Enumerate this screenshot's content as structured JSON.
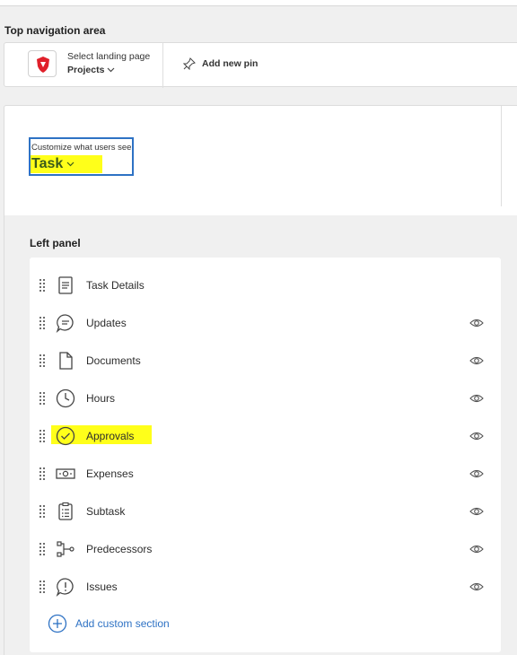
{
  "top_nav": {
    "section_title": "Top navigation area",
    "landing_label": "Select landing page",
    "landing_value": "Projects",
    "pin_label": "Add new pin"
  },
  "customize": {
    "label": "Customize what users see",
    "value": "Task"
  },
  "left_panel": {
    "title": "Left panel",
    "items": [
      {
        "label": "Task Details",
        "icon": "document-lines-icon",
        "visibility_toggle": false,
        "highlighted": false
      },
      {
        "label": "Updates",
        "icon": "chat-bubble-icon",
        "visibility_toggle": true,
        "highlighted": false
      },
      {
        "label": "Documents",
        "icon": "file-icon",
        "visibility_toggle": true,
        "highlighted": false
      },
      {
        "label": "Hours",
        "icon": "clock-icon",
        "visibility_toggle": true,
        "highlighted": false
      },
      {
        "label": "Approvals",
        "icon": "check-circle-icon",
        "visibility_toggle": true,
        "highlighted": true
      },
      {
        "label": "Expenses",
        "icon": "money-icon",
        "visibility_toggle": true,
        "highlighted": false
      },
      {
        "label": "Subtask",
        "icon": "clipboard-list-icon",
        "visibility_toggle": true,
        "highlighted": false
      },
      {
        "label": "Predecessors",
        "icon": "workflow-icon",
        "visibility_toggle": true,
        "highlighted": false
      },
      {
        "label": "Issues",
        "icon": "alert-bubble-icon",
        "visibility_toggle": true,
        "highlighted": false
      }
    ],
    "add_custom_label": "Add custom section"
  },
  "colors": {
    "accent": "#2e72c4",
    "highlight": "#ffff1a",
    "logo_red": "#e0202a"
  }
}
